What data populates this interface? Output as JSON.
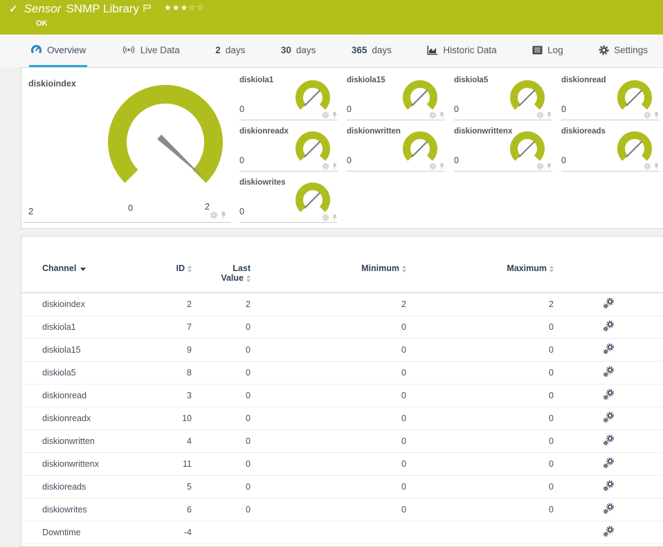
{
  "header": {
    "check_glyph": "✓",
    "title_italic": "Sensor",
    "title_main": "SNMP Library",
    "stars_filled": "★★★",
    "stars_empty": "☆☆",
    "status": "OK"
  },
  "tabs": {
    "overview": {
      "label": "Overview"
    },
    "live_data": {
      "label": "Live Data"
    },
    "days2": {
      "num": "2",
      "unit": "days"
    },
    "days30": {
      "num": "30",
      "unit": "days"
    },
    "days365": {
      "num": "365",
      "unit": "days"
    },
    "historic": {
      "label": "Historic Data"
    },
    "log": {
      "label": "Log"
    },
    "settings": {
      "label": "Settings"
    }
  },
  "gauges": {
    "large": {
      "title": "diskioindex",
      "value": "2",
      "scale_min": "0",
      "scale_max": "2"
    },
    "small": [
      {
        "title": "diskiola1",
        "value": "0"
      },
      {
        "title": "diskiola15",
        "value": "0"
      },
      {
        "title": "diskiola5",
        "value": "0"
      },
      {
        "title": "diskionread",
        "value": "0"
      },
      {
        "title": "diskionreadx",
        "value": "0"
      },
      {
        "title": "diskionwritten",
        "value": "0"
      },
      {
        "title": "diskionwrittenx",
        "value": "0"
      },
      {
        "title": "diskioreads",
        "value": "0"
      },
      {
        "title": "diskiowrites",
        "value": "0"
      }
    ]
  },
  "table": {
    "headers": {
      "channel": "Channel",
      "id": "ID",
      "last_value": "Last Value",
      "minimum": "Minimum",
      "maximum": "Maximum"
    },
    "rows": [
      {
        "channel": "diskioindex",
        "id": "2",
        "last": "2",
        "min": "2",
        "max": "2"
      },
      {
        "channel": "diskiola1",
        "id": "7",
        "last": "0",
        "min": "0",
        "max": "0"
      },
      {
        "channel": "diskiola15",
        "id": "9",
        "last": "0",
        "min": "0",
        "max": "0"
      },
      {
        "channel": "diskiola5",
        "id": "8",
        "last": "0",
        "min": "0",
        "max": "0"
      },
      {
        "channel": "diskionread",
        "id": "3",
        "last": "0",
        "min": "0",
        "max": "0"
      },
      {
        "channel": "diskionreadx",
        "id": "10",
        "last": "0",
        "min": "0",
        "max": "0"
      },
      {
        "channel": "diskionwritten",
        "id": "4",
        "last": "0",
        "min": "0",
        "max": "0"
      },
      {
        "channel": "diskionwrittenx",
        "id": "11",
        "last": "0",
        "min": "0",
        "max": "0"
      },
      {
        "channel": "diskioreads",
        "id": "5",
        "last": "0",
        "min": "0",
        "max": "0"
      },
      {
        "channel": "diskiowrites",
        "id": "6",
        "last": "0",
        "min": "0",
        "max": "0"
      },
      {
        "channel": "Downtime",
        "id": "-4",
        "last": "",
        "min": "",
        "max": ""
      }
    ]
  },
  "colors": {
    "header_green": "#b2bf1b",
    "gauge_green": "#b0bd1e",
    "active_tab_blue": "#2ba4da",
    "overview_icon_blue": "#1d8fd1",
    "navy_text": "#2f4157",
    "needle_gray": "#8a8a8a"
  }
}
